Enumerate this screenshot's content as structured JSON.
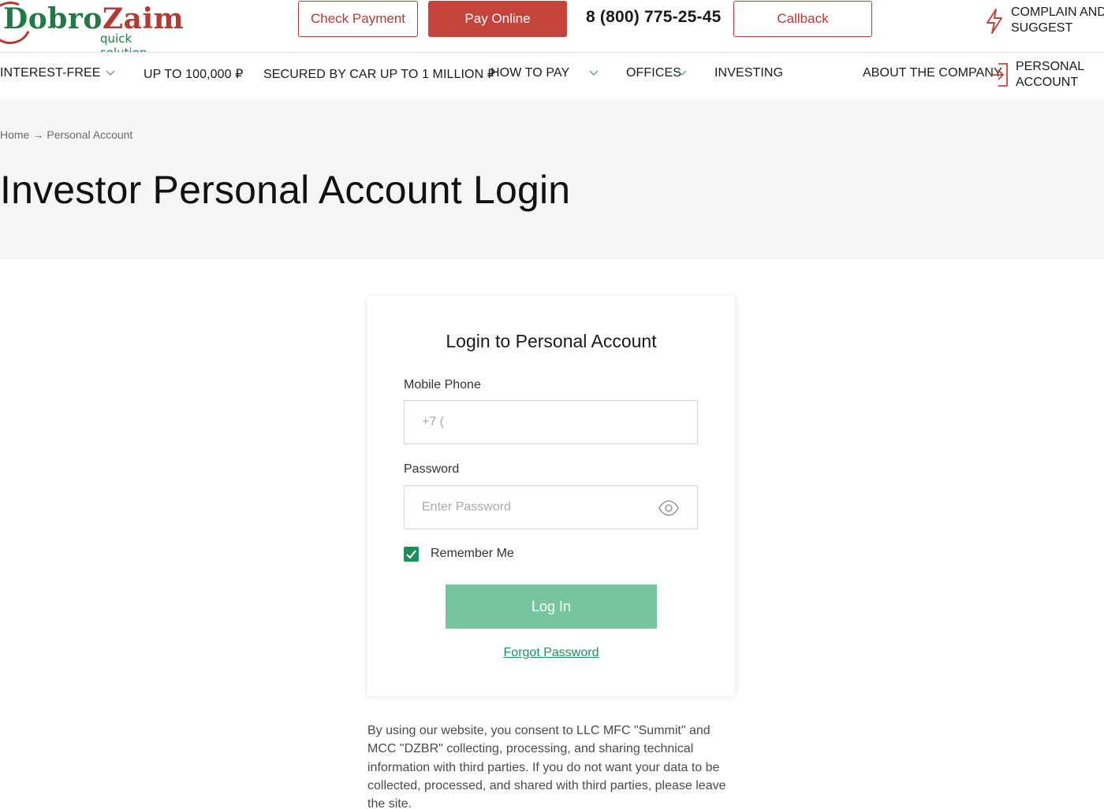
{
  "logo": {
    "part1": "Dobro",
    "part2": "Zaim",
    "tagline": "quick solution"
  },
  "header": {
    "check_payment": "Check Payment",
    "pay_online": "Pay Online",
    "phone": "8 (800) 775-25-45",
    "callback": "Callback",
    "complain_line1": "COMPLAIN AND",
    "complain_line2": "SUGGEST"
  },
  "nav": {
    "items": [
      {
        "label": "INTEREST-FREE"
      },
      {
        "label": "UP TO 100,000 ₽"
      },
      {
        "label": "SECURED BY CAR UP TO 1 MILLION ₽"
      },
      {
        "label": "HOW TO PAY"
      },
      {
        "label": "OFFICES"
      },
      {
        "label": "INVESTING"
      },
      {
        "label": "ABOUT THE COMPANY"
      }
    ],
    "account_line1": "PERSONAL",
    "account_line2": "ACCOUNT"
  },
  "breadcrumb": {
    "home": "Home",
    "sep": "→",
    "current": "Personal Account"
  },
  "page_title": "Investor Personal Account Login",
  "login": {
    "title": "Login to Personal Account",
    "phone_label": "Mobile Phone",
    "phone_placeholder": "+7 (",
    "password_label": "Password",
    "password_placeholder": "Enter Password",
    "remember_label": "Remember Me",
    "remember_checked": true,
    "submit_label": "Log In",
    "forgot_label": "Forgot Password"
  },
  "consent_text": "By using our website, you consent to LLC MFC \"Summit\" and MCC \"DZBR\" collecting, processing, and sharing technical information with third parties. If you do not want your data to be collected, processed, and shared with third parties, please leave the site.",
  "colors": {
    "brand_red": "#c4443c",
    "brand_green": "#1f7a45",
    "accent_green": "#1e8f5a",
    "button_green": "#77c59f",
    "hero_bg": "#f6f6f6"
  },
  "icons": {
    "nav_chevron": "chevron-down-icon",
    "complain": "lightning-icon",
    "account": "login-icon",
    "password_toggle": "eye-icon",
    "remember": "checkmark-icon"
  }
}
